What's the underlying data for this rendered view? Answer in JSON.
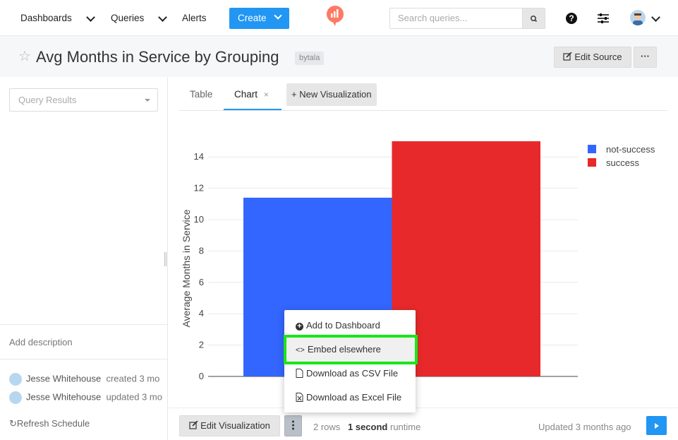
{
  "nav": {
    "dashboards": "Dashboards",
    "queries": "Queries",
    "alerts": "Alerts",
    "create": "Create",
    "search_placeholder": "Search queries...",
    "help_glyph": "?"
  },
  "header": {
    "title": "Avg Months in Service by Grouping",
    "tag": "bytala",
    "edit_source": "Edit Source",
    "more": "···"
  },
  "sidebar": {
    "query_results": "Query Results",
    "add_description": "Add description",
    "activity": [
      {
        "user": "Jesse Whitehouse",
        "action": "created 3 mo"
      },
      {
        "user": "Jesse Whitehouse",
        "action": "updated 3 mo"
      }
    ],
    "refresh_schedule": "Refresh Schedule"
  },
  "tabs": {
    "table": "Table",
    "chart": "Chart",
    "close": "×",
    "new_visualization": "+ New Visualization"
  },
  "chart_data": {
    "type": "bar",
    "ylabel": "Average Months in Service",
    "ylim": [
      0,
      15
    ],
    "yticks": [
      0,
      2,
      4,
      6,
      8,
      10,
      12,
      14
    ],
    "series": [
      {
        "name": "not-success",
        "color": "#3366ff",
        "value": 11.4
      },
      {
        "name": "success",
        "color": "#e8292b",
        "value": 15.0
      }
    ]
  },
  "menu": {
    "add_to_dashboard": "Add to Dashboard",
    "embed": "Embed elsewhere",
    "csv": "Download as CSV File",
    "excel": "Download as Excel File"
  },
  "footer": {
    "edit_visualization": "Edit Visualization",
    "rows": "2 rows",
    "runtime_value": "1 second",
    "runtime_label": "runtime",
    "updated": "Updated 3 months ago"
  }
}
